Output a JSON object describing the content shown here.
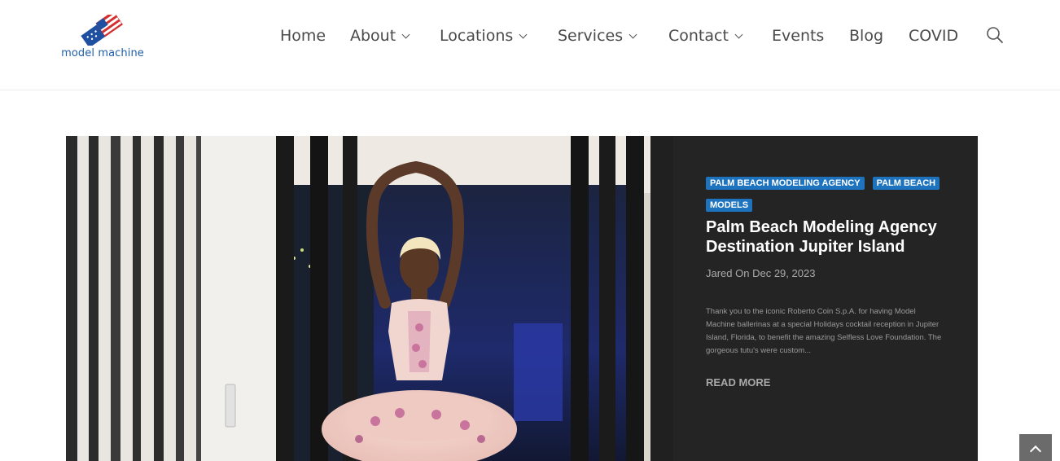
{
  "brand": {
    "logo_text": "model machine",
    "colors": {
      "blue": "#1f5fa8",
      "red": "#d32f2f"
    }
  },
  "nav": {
    "items": [
      {
        "label": "Home",
        "dropdown": false
      },
      {
        "label": "About",
        "dropdown": true
      },
      {
        "label": "Locations",
        "dropdown": true
      },
      {
        "label": "Services",
        "dropdown": true
      },
      {
        "label": "Contact",
        "dropdown": true
      },
      {
        "label": "Events",
        "dropdown": false
      },
      {
        "label": "Blog",
        "dropdown": false
      },
      {
        "label": "COVID",
        "dropdown": false
      }
    ],
    "search_icon": "magnifier-icon"
  },
  "featured_post": {
    "image_alt_icon": "ballerina-photo",
    "tags": [
      "PALM BEACH MODELING AGENCY",
      "PALM BEACH MODELS"
    ],
    "title": "Palm Beach Modeling Agency Destination Jupiter Island",
    "meta": "Jared On Dec 29, 2023",
    "excerpt": "Thank you to the iconic Roberto Coin S.p.A. for having Model Machine ballerinas at a special Holidays cocktail reception in Jupiter Island, Florida, to benefit the amazing Selfless Love Foundation. The gorgeous tutu's were custom...",
    "read_more": "READ MORE",
    "colors": {
      "panel": "#242424",
      "tag_bg": "#1e73be"
    }
  },
  "scroll_top": {
    "icon": "chevron-up-icon"
  }
}
